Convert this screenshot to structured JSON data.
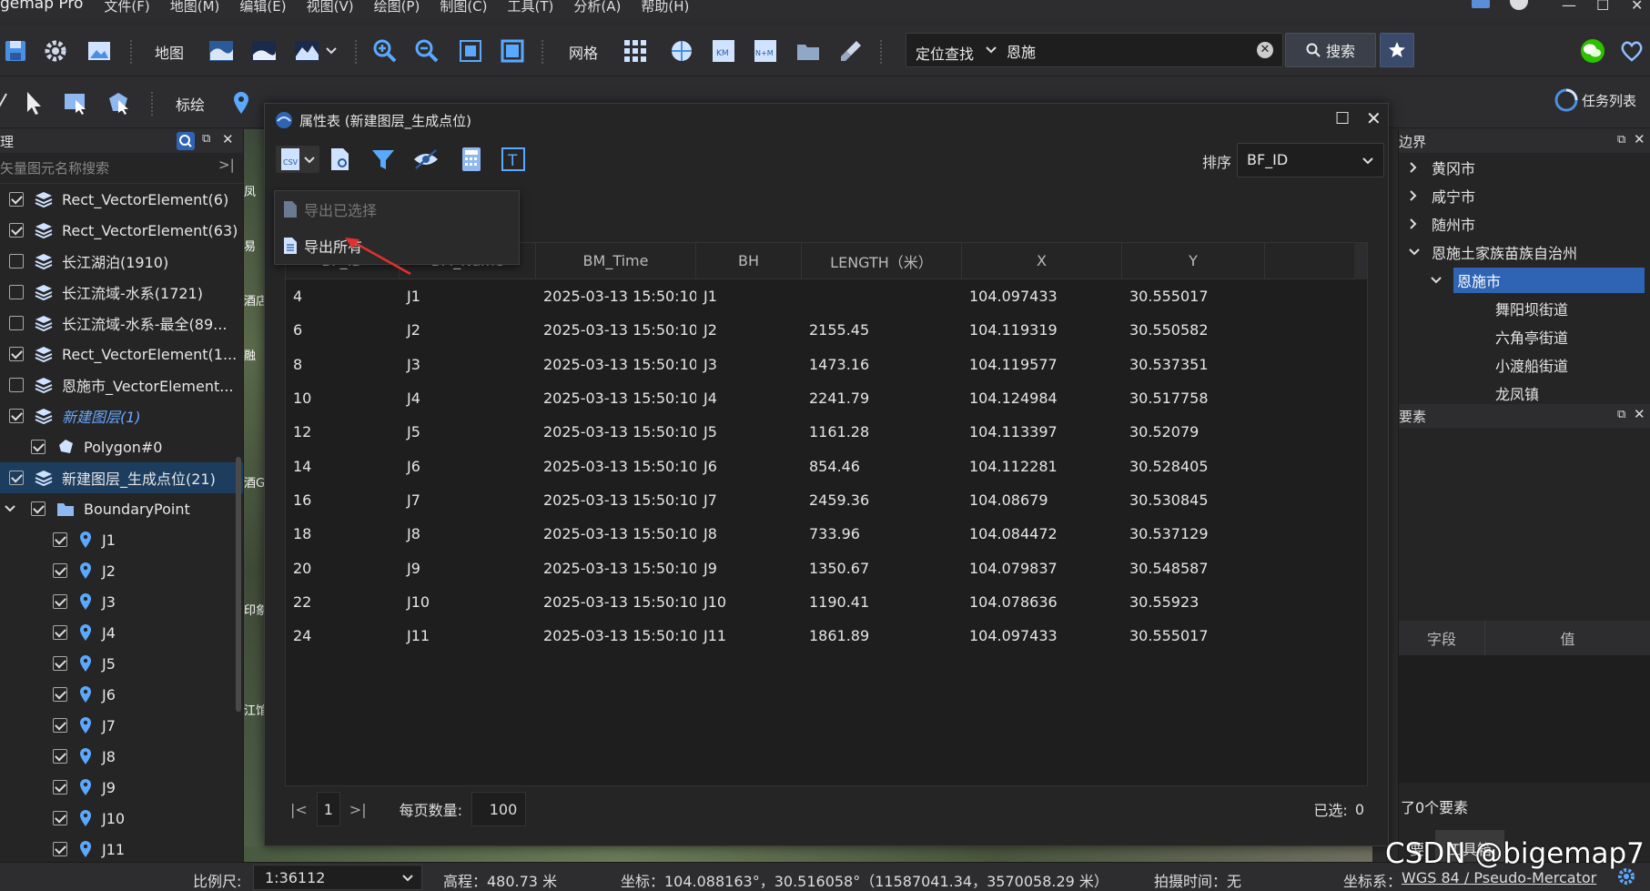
{
  "menubar": {
    "app_title": "gemap Pro",
    "items": [
      "文件(F)",
      "地图(M)",
      "编辑(E)",
      "视图(V)",
      "绘图(P)",
      "制图(C)",
      "工具(T)",
      "分析(A)",
      "帮助(H)"
    ]
  },
  "toolbar1": {
    "map_label": "地图",
    "grid_label": "网格",
    "locate_scope": "定位查找",
    "search_value": "恩施",
    "search_button": "搜索"
  },
  "toolbar2": {
    "annotation_label": "标绘",
    "task_list_label": "任务列表"
  },
  "left_panel": {
    "title": "理",
    "search_placeholder": "矢量图元名称搜索",
    "layers": [
      {
        "label": "Rect_VectorElement(6)",
        "checked": true,
        "indent": 0,
        "icon": "layers-icon"
      },
      {
        "label": "Rect_VectorElement(63)",
        "checked": true,
        "indent": 0,
        "icon": "layers-icon"
      },
      {
        "label": "长江湖泊(1910)",
        "checked": false,
        "indent": 0,
        "icon": "layers-icon"
      },
      {
        "label": "长江流域-水系(1721)",
        "checked": false,
        "indent": 0,
        "icon": "layers-icon"
      },
      {
        "label": "长江流域-水系-最全(89...",
        "checked": false,
        "indent": 0,
        "icon": "layers-icon"
      },
      {
        "label": "Rect_VectorElement(1...",
        "checked": true,
        "indent": 0,
        "icon": "layers-icon"
      },
      {
        "label": "恩施市_VectorElement...",
        "checked": false,
        "indent": 0,
        "icon": "layers-icon"
      },
      {
        "label": "新建图层(1)",
        "checked": true,
        "indent": 0,
        "icon": "layers-icon",
        "style": "italic-blue"
      },
      {
        "label": "Polygon#0",
        "checked": true,
        "indent": 1,
        "icon": "polygon-icon"
      },
      {
        "label": "新建图层_生成点位(21)",
        "checked": true,
        "indent": 0,
        "icon": "layers-icon",
        "selected": true
      },
      {
        "label": "BoundaryPoint",
        "checked": true,
        "indent": 1,
        "icon": "folder-icon",
        "expand": true
      },
      {
        "label": "J1",
        "checked": true,
        "indent": 2,
        "icon": "pin-icon"
      },
      {
        "label": "J2",
        "checked": true,
        "indent": 2,
        "icon": "pin-icon"
      },
      {
        "label": "J3",
        "checked": true,
        "indent": 2,
        "icon": "pin-icon"
      },
      {
        "label": "J4",
        "checked": true,
        "indent": 2,
        "icon": "pin-icon"
      },
      {
        "label": "J5",
        "checked": true,
        "indent": 2,
        "icon": "pin-icon"
      },
      {
        "label": "J6",
        "checked": true,
        "indent": 2,
        "icon": "pin-icon"
      },
      {
        "label": "J7",
        "checked": true,
        "indent": 2,
        "icon": "pin-icon"
      },
      {
        "label": "J8",
        "checked": true,
        "indent": 2,
        "icon": "pin-icon"
      },
      {
        "label": "J9",
        "checked": true,
        "indent": 2,
        "icon": "pin-icon"
      },
      {
        "label": "J10",
        "checked": true,
        "indent": 2,
        "icon": "pin-icon"
      },
      {
        "label": "J11",
        "checked": true,
        "indent": 2,
        "icon": "pin-icon"
      }
    ]
  },
  "map_side_labels": [
    "凤",
    "易",
    "酒店",
    "融",
    "酒G",
    "印象",
    "江馆"
  ],
  "attr_window": {
    "title": "属性表 (新建图层_生成点位)",
    "sort_label": "排序",
    "sort_value": "BF_ID",
    "export_menu": {
      "export_selected": "导出已选择",
      "export_all": "导出所有"
    },
    "columns": [
      "BF_ID",
      "BM_Name",
      "BM_Time",
      "BH",
      "LENGTH（米）",
      "X",
      "Y"
    ],
    "rows": [
      [
        "4",
        "J1",
        "2025-03-13 15:50:10",
        "J1",
        "",
        "104.097433",
        "30.555017"
      ],
      [
        "6",
        "J2",
        "2025-03-13 15:50:10",
        "J2",
        "2155.45",
        "104.119319",
        "30.550582"
      ],
      [
        "8",
        "J3",
        "2025-03-13 15:50:10",
        "J3",
        "1473.16",
        "104.119577",
        "30.537351"
      ],
      [
        "10",
        "J4",
        "2025-03-13 15:50:10",
        "J4",
        "2241.79",
        "104.124984",
        "30.517758"
      ],
      [
        "12",
        "J5",
        "2025-03-13 15:50:10",
        "J5",
        "1161.28",
        "104.113397",
        "30.52079"
      ],
      [
        "14",
        "J6",
        "2025-03-13 15:50:10",
        "J6",
        "854.46",
        "104.112281",
        "30.528405"
      ],
      [
        "16",
        "J7",
        "2025-03-13 15:50:10",
        "J7",
        "2459.36",
        "104.08679",
        "30.530845"
      ],
      [
        "18",
        "J8",
        "2025-03-13 15:50:10",
        "J8",
        "733.96",
        "104.084472",
        "30.537129"
      ],
      [
        "20",
        "J9",
        "2025-03-13 15:50:10",
        "J9",
        "1350.67",
        "104.079837",
        "30.548587"
      ],
      [
        "22",
        "J10",
        "2025-03-13 15:50:10",
        "J10",
        "1190.41",
        "104.078636",
        "30.55923"
      ],
      [
        "24",
        "J11",
        "2025-03-13 15:50:10",
        "J11",
        "1861.89",
        "104.097433",
        "30.555017"
      ]
    ],
    "pager": {
      "first": "|<",
      "page": "1",
      "last": ">|",
      "page_size_label": "每页数量:",
      "page_size": "100",
      "selected_label": "已选:",
      "selected_count": "0"
    }
  },
  "right_panel": {
    "boundary_title": "边界",
    "tree": [
      {
        "label": "黄冈市",
        "indent": 0,
        "arrow": "right"
      },
      {
        "label": "咸宁市",
        "indent": 0,
        "arrow": "right"
      },
      {
        "label": "随州市",
        "indent": 0,
        "arrow": "right"
      },
      {
        "label": "恩施土家族苗族自治州",
        "indent": 0,
        "arrow": "down"
      },
      {
        "label": "恩施市",
        "indent": 1,
        "arrow": "down",
        "selected": true
      },
      {
        "label": "舞阳坝街道",
        "indent": 2,
        "arrow": ""
      },
      {
        "label": "六角亭街道",
        "indent": 2,
        "arrow": ""
      },
      {
        "label": "小渡船街道",
        "indent": 2,
        "arrow": ""
      },
      {
        "label": "龙凤镇",
        "indent": 2,
        "arrow": ""
      }
    ],
    "elements_title": "要素",
    "field_col": "字段",
    "value_col": "值",
    "count_text": "了0个要素",
    "tab_elements": "要",
    "tab_toolbox": "工具箱"
  },
  "statusbar": {
    "scale_label": "比例尺:",
    "scale_value": "1:36112",
    "elevation": "高程：480.73 米",
    "coords": "坐标：104.088163°，30.516058°（11587041.34，3570058.29 米）",
    "capture_time": "拍摄时间：无",
    "crs_label": "坐标系：",
    "crs_value": "WGS 84 / Pseudo-Mercator"
  },
  "watermark": "CSDN @bigemap7",
  "colors": {
    "accent_blue": "#2f64b5",
    "selected_row": "#1c3d5e",
    "arrow_red": "#e03030",
    "pin_blue": "#5aa9ff"
  }
}
